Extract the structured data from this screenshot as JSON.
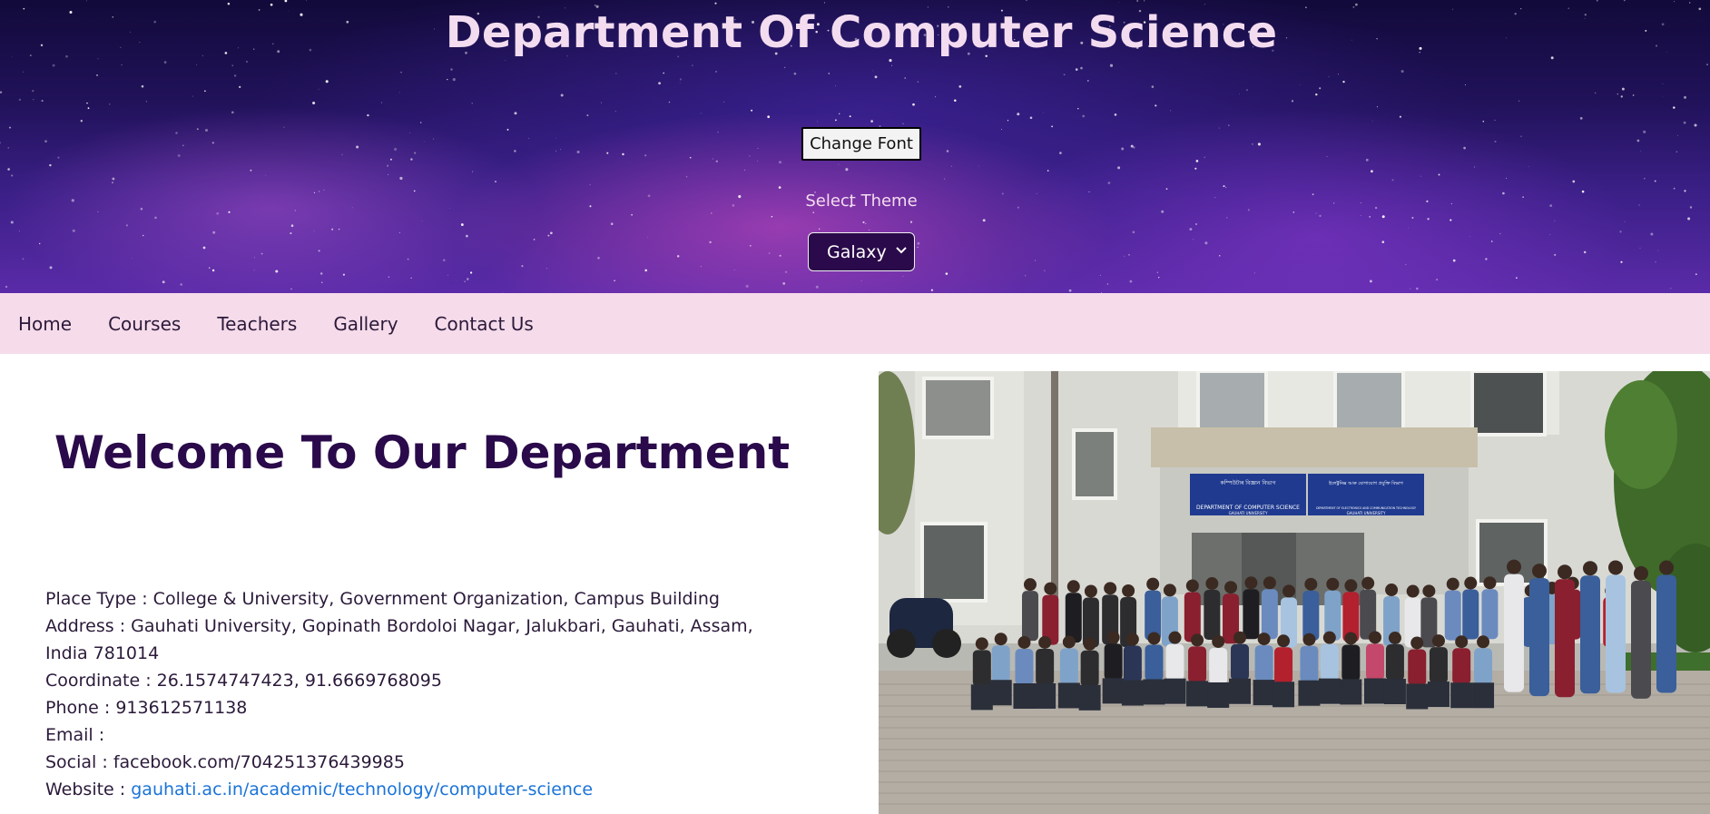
{
  "header": {
    "title": "Department Of Computer Science",
    "change_font_label": "Change Font",
    "theme_label": "Select Theme",
    "theme_selected": "Galaxy"
  },
  "nav": {
    "items": [
      "Home",
      "Courses",
      "Teachers",
      "Gallery",
      "Contact Us"
    ]
  },
  "main": {
    "welcome": "Welcome To Our Department",
    "info": {
      "place_type": "Place Type : College & University, Government Organization, Campus Building",
      "address": "Address : Gauhati University, Gopinath Bordoloi Nagar, Jalukbari, Gauhati, Assam, India 781014",
      "coordinate": "Coordinate : 26.1574747423, 91.6669768095",
      "phone": "Phone : 913612571138",
      "email": "Email :",
      "social": "Social : facebook.com/704251376439985",
      "website_label": "Website : ",
      "website_link": "gauhati.ac.in/academic/technology/computer-science"
    },
    "photo": {
      "sign_left_script": "কম্পিউটাৰ বিজ্ঞান বিভাগ",
      "sign_left": "DEPARTMENT OF COMPUTER SCIENCE",
      "sign_left_sub": "GAUHATI UNIVERSITY",
      "sign_right_script": "ইলেক্ট্ৰনিক্স আৰু যোগাযোগ প্ৰযুক্তি বিভাগ",
      "sign_right": "DEPARTMENT OF ELECTRONICS AND COMMUNICATION TECHNOLOGY",
      "sign_right_sub": "GAUHATI UNIVERSITY"
    }
  },
  "colors": {
    "nav_bg": "#f6dbea",
    "title_text": "#f3dcef",
    "welcome_text": "#2a0a4a",
    "link": "#1a73d9",
    "select_bg": "#2a0a4a"
  }
}
